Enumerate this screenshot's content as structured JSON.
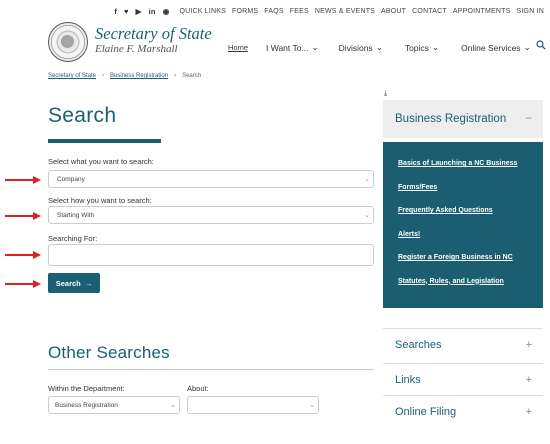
{
  "topbar": {
    "social": [
      "f",
      "♥",
      "▶",
      "in",
      "◉"
    ],
    "links": [
      "QUICK LINKS",
      "FORMS",
      "FAQS",
      "FEES",
      "NEWS & EVENTS",
      "ABOUT",
      "CONTACT",
      "APPOINTMENTS",
      "SIGN IN"
    ]
  },
  "brand": {
    "title": "Secretary of State",
    "subtitle": "Elaine F. Marshall"
  },
  "nav": [
    {
      "label": "Home",
      "chevron": ""
    },
    {
      "label": "I Want To...",
      "chevron": "⌄"
    },
    {
      "label": "Divisions",
      "chevron": "⌄"
    },
    {
      "label": "Topics",
      "chevron": "⌄"
    },
    {
      "label": "Online Services",
      "chevron": "⌄"
    }
  ],
  "breadcrumb": {
    "items": [
      "Secretary of State",
      "Business Registration",
      "Search"
    ],
    "separator": "›"
  },
  "page_title": "Search",
  "form": {
    "what_label": "Select what you want to search:",
    "what_value": "Company",
    "how_label": "Select how you want to search:",
    "how_value": "Starting With",
    "for_label": "Searching For:",
    "for_value": "",
    "search_button": "Search",
    "search_arrow": "→"
  },
  "other": {
    "title": "Other Searches",
    "within_label": "Within the Department:",
    "within_value": "Business Registration",
    "about_label": "About:",
    "about_value": ""
  },
  "sidebar": {
    "download_glyph": "⤓",
    "heading": "Business Registration",
    "heading_toggle": "−",
    "links": [
      "Basics of Launching a NC Business",
      "Forms/Fees",
      "Frequently Asked Questions",
      "Alerts!",
      "Register a Foreign Business in NC",
      "Statutes, Rules, and Legislation"
    ],
    "accordions": [
      {
        "label": "Searches",
        "toggle": "+"
      },
      {
        "label": "Links",
        "toggle": "+"
      },
      {
        "label": "Online Filing",
        "toggle": "+"
      }
    ]
  },
  "colors": {
    "accent": "#1a5f73",
    "annotation_arrow": "#e02020"
  }
}
